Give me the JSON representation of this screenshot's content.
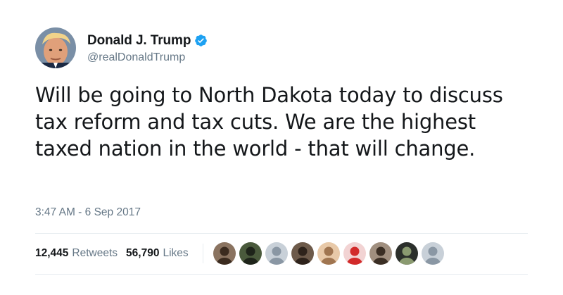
{
  "user": {
    "display_name": "Donald J. Trump",
    "handle": "@realDonaldTrump",
    "verified": true
  },
  "tweet": {
    "text": "Will be going to North Dakota today to discuss tax reform and tax cuts. We are the highest taxed nation in the world - that will change.",
    "timestamp": "3:47 AM - 6 Sep 2017"
  },
  "stats": {
    "retweets_count": "12,445",
    "retweets_label": "Retweets",
    "likes_count": "56,790",
    "likes_label": "Likes"
  },
  "likers": [
    {
      "name": "liker-1",
      "bg": "#8a7360",
      "fg": "#3b2b1f"
    },
    {
      "name": "liker-2",
      "bg": "#4a5a3c",
      "fg": "#1e241a"
    },
    {
      "name": "liker-3",
      "bg": "#c8d0d8",
      "fg": "#8a97a4"
    },
    {
      "name": "liker-4",
      "bg": "#6d5a4a",
      "fg": "#2e231b"
    },
    {
      "name": "liker-5",
      "bg": "#e8c9a8",
      "fg": "#a07550"
    },
    {
      "name": "liker-6",
      "bg": "#f2d3d3",
      "fg": "#d22a2a"
    },
    {
      "name": "liker-7",
      "bg": "#a08f7f",
      "fg": "#3a2e24"
    },
    {
      "name": "liker-8",
      "bg": "#2b2f2b",
      "fg": "#8a9a70"
    },
    {
      "name": "liker-9",
      "bg": "#c8d0d8",
      "fg": "#8a97a4"
    }
  ],
  "colors": {
    "verified_blue": "#1da1f2",
    "secondary_text": "#657786",
    "primary_text": "#14171a"
  }
}
